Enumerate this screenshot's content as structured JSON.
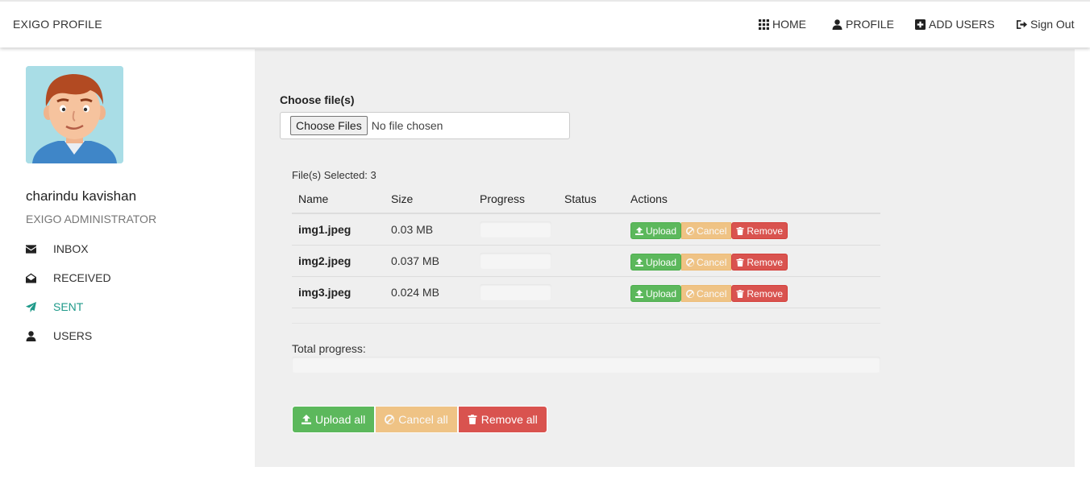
{
  "nav": {
    "brand": "EXIGO PROFILE",
    "items": [
      {
        "label": "HOME",
        "icon": "grid-icon"
      },
      {
        "label": "PROFILE",
        "icon": "user-icon"
      },
      {
        "label": "ADD USERS",
        "icon": "plus-square-icon"
      },
      {
        "label": "Sign Out",
        "icon": "sign-out-icon"
      }
    ]
  },
  "profile": {
    "name": "charindu kavishan",
    "role": "EXIGO ADMINISTRATOR"
  },
  "sidebar": {
    "items": [
      {
        "label": "INBOX",
        "icon": "envelope-icon",
        "active": false
      },
      {
        "label": "RECEIVED",
        "icon": "envelope-open-icon",
        "active": false
      },
      {
        "label": "SENT",
        "icon": "paper-plane-icon",
        "active": true
      },
      {
        "label": "USERS",
        "icon": "user-icon",
        "active": false
      }
    ]
  },
  "upload": {
    "choose_label": "Choose file(s)",
    "choose_button": "Choose Files",
    "no_file": "No file chosen",
    "files_selected": "File(s) Selected: 3",
    "columns": [
      "Name",
      "Size",
      "Progress",
      "Status",
      "Actions"
    ],
    "rows": [
      {
        "name": "img1.jpeg",
        "size": "0.03 MB",
        "progress": 0,
        "status": ""
      },
      {
        "name": "img2.jpeg",
        "size": "0.037 MB",
        "progress": 0,
        "status": ""
      },
      {
        "name": "img3.jpeg",
        "size": "0.024 MB",
        "progress": 0,
        "status": ""
      }
    ],
    "row_actions": {
      "upload": "Upload",
      "cancel": "Cancel",
      "remove": "Remove"
    },
    "total_label": "Total progress:",
    "total_progress": 0,
    "bulk_actions": {
      "upload": "Upload all",
      "cancel": "Cancel all",
      "remove": "Remove all"
    }
  },
  "colors": {
    "success": "#5cb85c",
    "warning": "#f0ad4e",
    "danger": "#d9534f",
    "active_menu": "#1f9a8a",
    "panel_bg": "#efefef"
  }
}
